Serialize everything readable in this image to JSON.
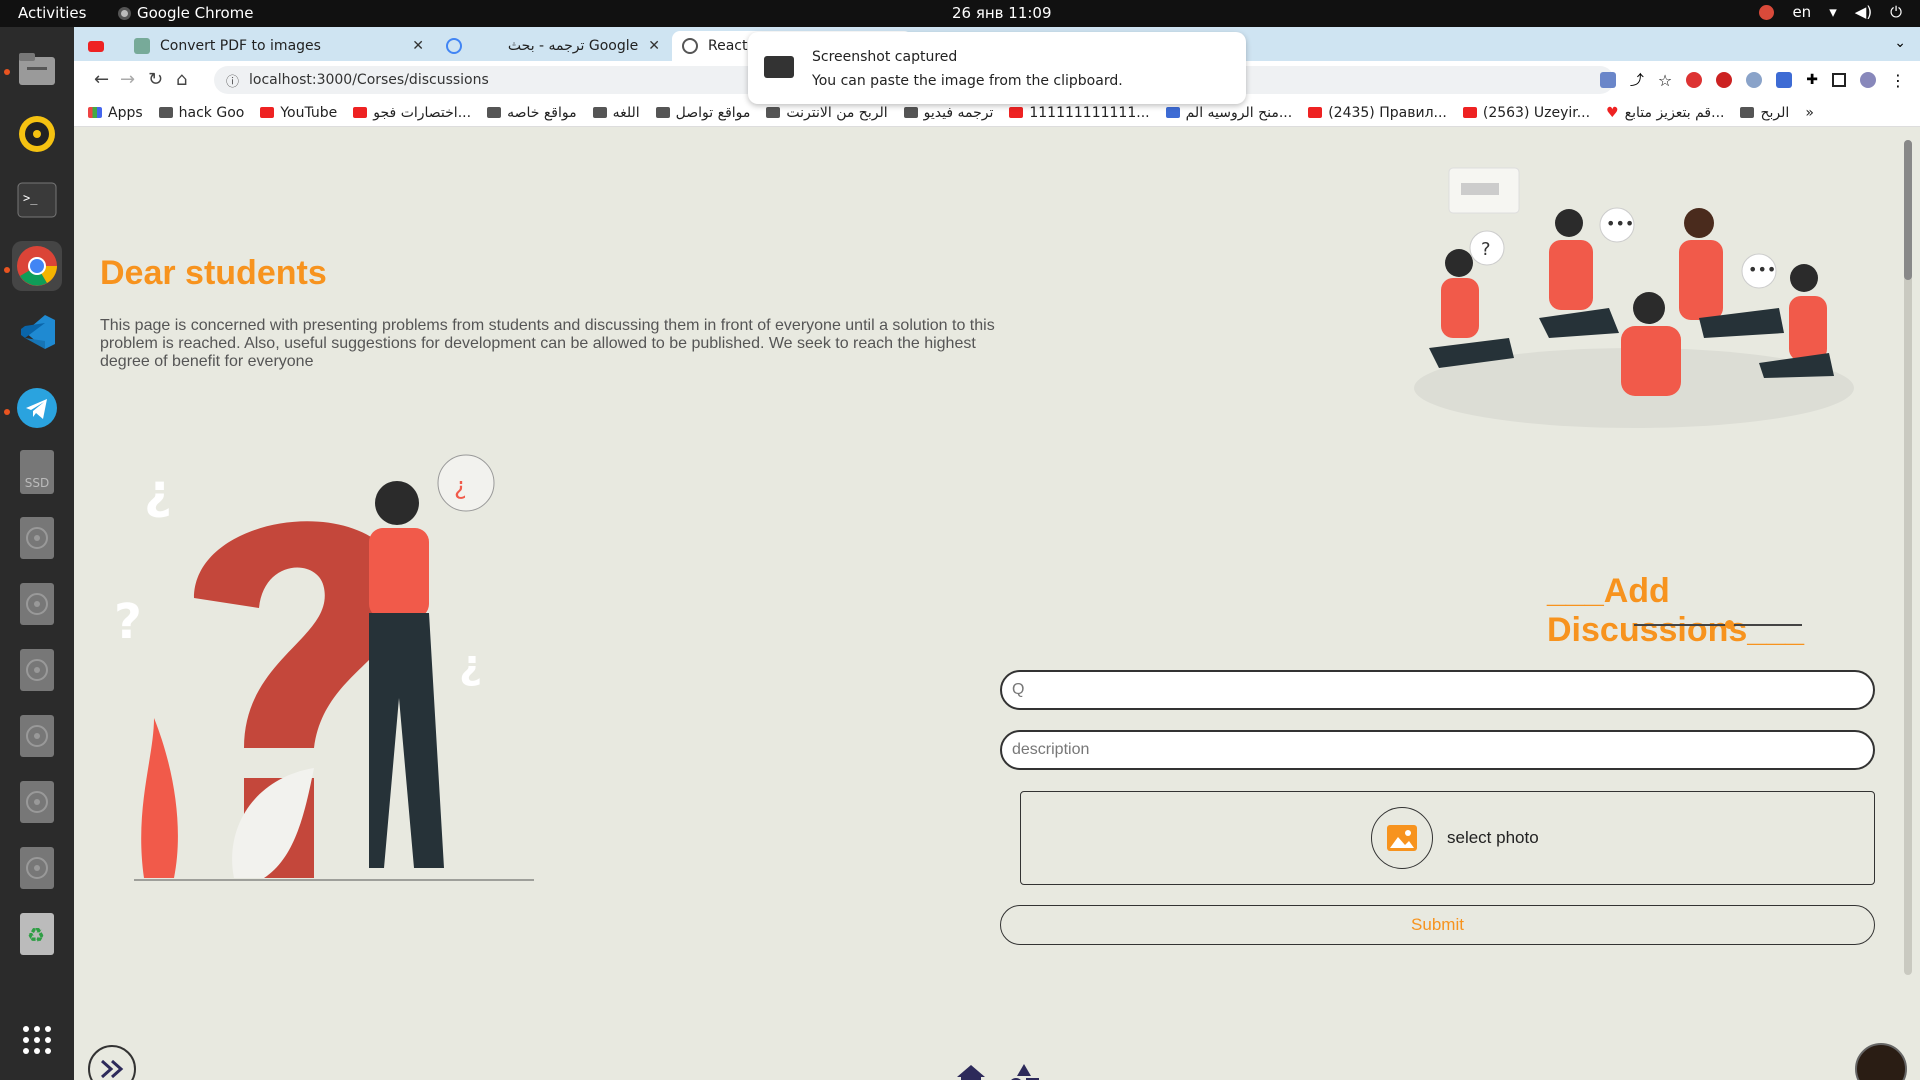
{
  "topbar": {
    "activities": "Activities",
    "app_name": "Google Chrome",
    "clock": "26 янв  11:09",
    "lang": "en"
  },
  "dock": {
    "icons": [
      "files-icon",
      "rhythmbox-icon",
      "terminal-icon",
      "chrome-icon",
      "vscode-icon",
      "telegram-icon",
      "ssd-drive-icon",
      "disk-icon",
      "disk-icon",
      "disk-icon",
      "disk-icon",
      "disk-icon",
      "disk-icon",
      "trash-icon",
      "show-apps-icon"
    ],
    "ssd_label": "SSD"
  },
  "browser": {
    "tabs": [
      {
        "label": "Convert PDF to images"
      },
      {
        "label": "ترجمه - بحث Google"
      },
      {
        "label": "React App"
      }
    ],
    "url": "localhost:3000/Corses/discussions",
    "bookmarks": [
      "Apps",
      "hack Goo",
      "YouTube",
      "اختصارات فجو...",
      "مواقع خاصه",
      "اللغه",
      "مواقع تواصل",
      "الربح من الانترنت",
      "ترجمه فيديو",
      "111111111111...",
      "منح الروسيه الم...",
      "(2435) Правил...",
      "(2563) Uzeyir...",
      "قم بتعزيز متابع...",
      "الربح"
    ],
    "bookmarks_more": "»"
  },
  "notification": {
    "title": "Screenshot captured",
    "body": "You can paste the image from the clipboard."
  },
  "page": {
    "heading": "Dear students",
    "intro": "This page is concerned with presenting problems from students and discussing them in front of everyone until a solution to this problem is reached. Also, useful suggestions for development can be allowed to be published. We seek to reach the highest degree of benefit for everyone",
    "form": {
      "title": "___Add Discussions___",
      "question_placeholder": "Q",
      "description_placeholder": "description",
      "photo_label": "select photo",
      "submit_label": "Submit"
    }
  },
  "colors": {
    "accent": "#f7931e",
    "illustration": "#f15a4a",
    "background": "#e8e9e0"
  }
}
